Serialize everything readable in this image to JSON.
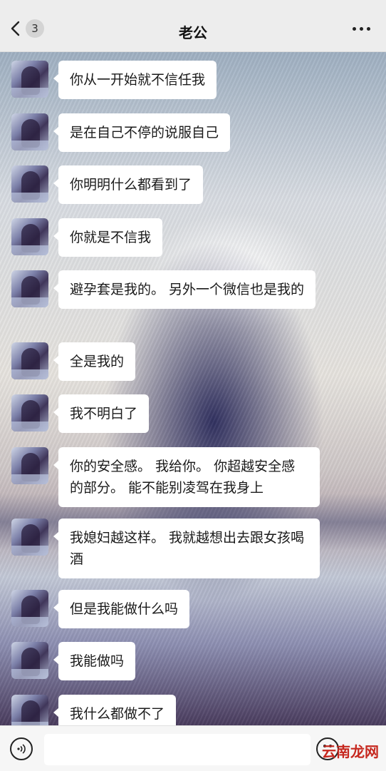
{
  "header": {
    "back_icon": "chevron-left-icon",
    "unread_count": "3",
    "title": "老公",
    "more_icon": "ellipsis-icon"
  },
  "messages": [
    {
      "text": "你从一开始就不信任我"
    },
    {
      "text": "是在自己不停的说服自己"
    },
    {
      "text": "你明明什么都看到了"
    },
    {
      "text": "你就是不信我"
    },
    {
      "text": "避孕套是我的。 另外一个微信也是我的"
    },
    {
      "text": "全是我的"
    },
    {
      "text": "我不明白了"
    },
    {
      "text": "你的安全感。 我给你。 你超越安全感的部分。 能不能别凌驾在我身上"
    },
    {
      "text": "我媳妇越这样。 我就越想出去跟女孩喝酒"
    },
    {
      "text": "但是我能做什么吗"
    },
    {
      "text": "我能做吗"
    },
    {
      "text": "我什么都做不了"
    }
  ],
  "bottom_bar": {
    "voice_icon": "voice-icon",
    "input_value": "",
    "emoji_icon": "emoji-icon"
  },
  "watermark": "云南龙网"
}
